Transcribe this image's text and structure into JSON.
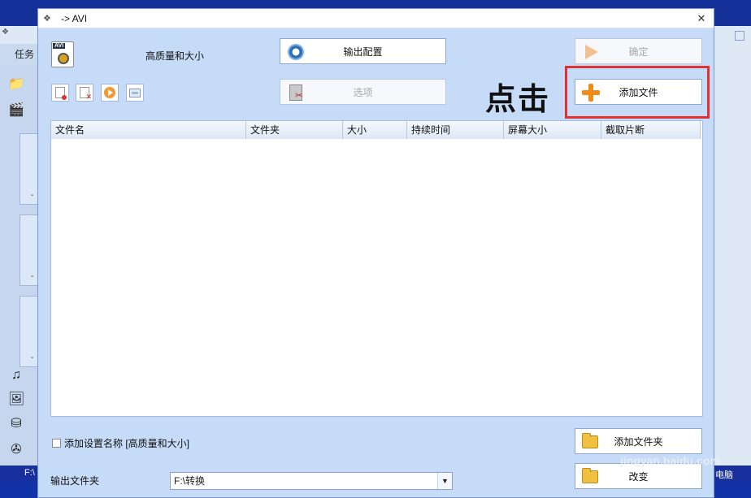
{
  "background_app": {
    "menu_task": "任务",
    "bottom_left_text": "F:\\",
    "bottom_right_text": "电脑",
    "dash": "-"
  },
  "dialog": {
    "title": "-> AVI",
    "quality_label": "高质量和大小",
    "output_config_button": "输出配置",
    "options_button": "选项",
    "confirm_button": "确定",
    "add_file_button": "添加文件",
    "add_folder_button": "添加文件夹",
    "change_button": "改变",
    "annotation": "点击",
    "file_list": {
      "columns": [
        "文件名",
        "文件夹",
        "大小",
        "持续时间",
        "屏幕大小",
        "截取片断"
      ],
      "rows": []
    },
    "add_settings_name_label": "添加设置名称 [高质量和大小]",
    "output_folder_label": "输出文件夹",
    "output_folder_value": "F:\\转换",
    "watermark": "jingyan.baidu.com"
  },
  "colors": {
    "highlight": "#e03030",
    "dialog_bg": "#c6dbf7",
    "plus_orange": "#f08a18"
  }
}
